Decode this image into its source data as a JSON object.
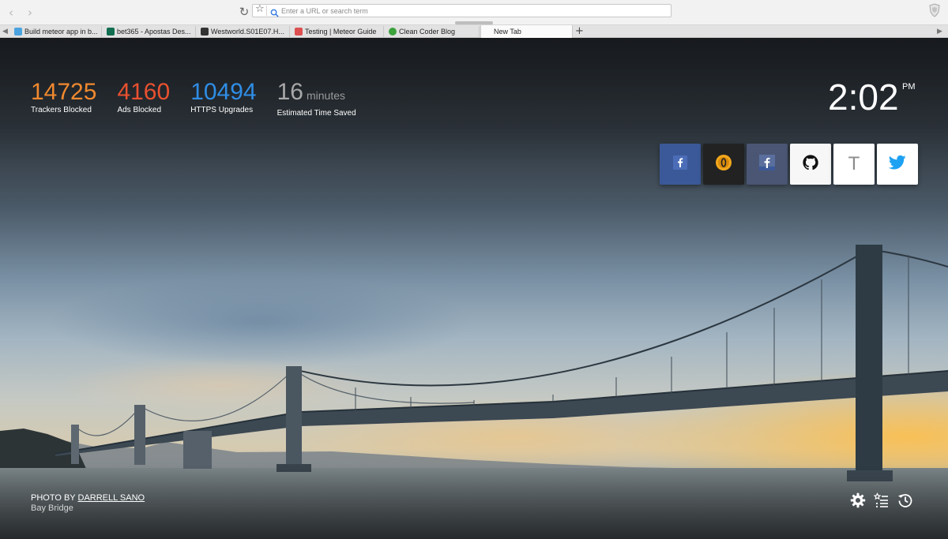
{
  "browser": {
    "url_placeholder": "Enter a URL or search term",
    "tabs": [
      {
        "title": "Build meteor app in b...",
        "favicon_color": "#4aa3df"
      },
      {
        "title": "bet365 - Apostas Des...",
        "favicon_color": "#126e51"
      },
      {
        "title": "Westworld.S01E07.H...",
        "favicon_color": "#333333"
      },
      {
        "title": "Testing | Meteor Guide",
        "favicon_color": "#de4f4f"
      },
      {
        "title": "Clean Coder Blog",
        "favicon_color": "#3ca23c"
      },
      {
        "title": "New Tab",
        "favicon_color": ""
      }
    ],
    "new_tab_label": "+"
  },
  "stats": [
    {
      "value": "14725",
      "unit": "",
      "label": "Trackers Blocked",
      "color": "#f0892f"
    },
    {
      "value": "4160",
      "unit": "",
      "label": "Ads Blocked",
      "color": "#e9512f"
    },
    {
      "value": "10494",
      "unit": "",
      "label": "HTTPS Upgrades",
      "color": "#2f8ee6"
    },
    {
      "value": "16",
      "unit": "minutes",
      "label": "Estimated Time Saved",
      "color": "#a8a8a8"
    }
  ],
  "clock": {
    "time": "2:02",
    "ampm": "PM"
  },
  "top_sites": [
    {
      "name": "facebook",
      "icon": "facebook-icon",
      "bg": "#3b5998"
    },
    {
      "name": "overwolf",
      "icon": "coin-icon",
      "bg": "#222222"
    },
    {
      "name": "facebook-alt",
      "icon": "facebook-icon",
      "bg": "#4b5675"
    },
    {
      "name": "github",
      "icon": "github-icon",
      "bg": "#f7f7f7"
    },
    {
      "name": "letter-t",
      "icon": "letter-t-icon",
      "letter": "T",
      "bg": "#ffffff"
    },
    {
      "name": "twitter",
      "icon": "twitter-icon",
      "bg": "#ffffff"
    }
  ],
  "credit": {
    "prefix": "PHOTO BY",
    "photographer": "DARRELL SANO",
    "location": "Bay Bridge"
  },
  "actions": [
    "gear-icon",
    "bookmarks-icon",
    "history-icon"
  ]
}
